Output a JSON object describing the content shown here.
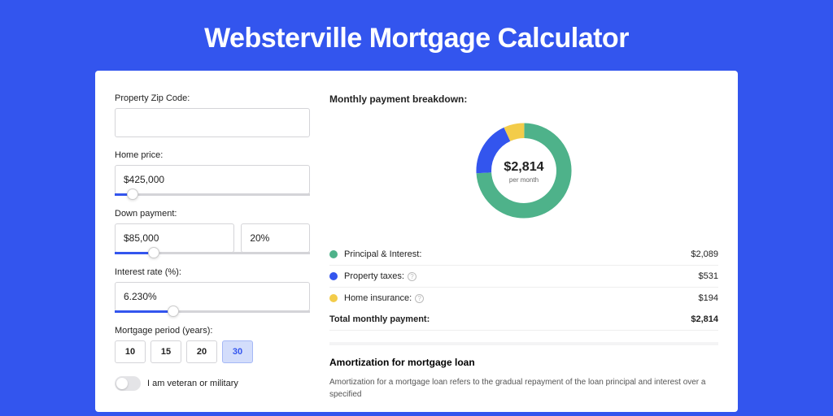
{
  "title": "Websterville Mortgage Calculator",
  "colors": {
    "principal": "#4eb28a",
    "taxes": "#3355ee",
    "insurance": "#f3cc4a"
  },
  "form": {
    "zip": {
      "label": "Property Zip Code:",
      "value": ""
    },
    "price": {
      "label": "Home price:",
      "value": "$425,000",
      "slider_pct": 9
    },
    "down": {
      "label": "Down payment:",
      "amount": "$85,000",
      "pct": "20%",
      "slider_pct": 20
    },
    "rate": {
      "label": "Interest rate (%):",
      "value": "6.230%",
      "slider_pct": 30
    },
    "period": {
      "label": "Mortgage period (years):",
      "options": [
        "10",
        "15",
        "20",
        "30"
      ],
      "selected": "30"
    },
    "veteran": {
      "label": "I am veteran or military",
      "on": false
    }
  },
  "breakdown": {
    "title": "Monthly payment breakdown:",
    "center_value": "$2,814",
    "center_sub": "per month",
    "items": [
      {
        "key": "principal",
        "label": "Principal & Interest:",
        "value": "$2,089",
        "info": false,
        "pct": 74
      },
      {
        "key": "taxes",
        "label": "Property taxes:",
        "value": "$531",
        "info": true,
        "pct": 19
      },
      {
        "key": "insurance",
        "label": "Home insurance:",
        "value": "$194",
        "info": true,
        "pct": 7
      }
    ],
    "total_label": "Total monthly payment:",
    "total_value": "$2,814"
  },
  "amort": {
    "title": "Amortization for mortgage loan",
    "text": "Amortization for a mortgage loan refers to the gradual repayment of the loan principal and interest over a specified"
  },
  "chart_data": {
    "type": "pie",
    "title": "Monthly payment breakdown",
    "series": [
      {
        "name": "Principal & Interest",
        "value": 2089
      },
      {
        "name": "Property taxes",
        "value": 531
      },
      {
        "name": "Home insurance",
        "value": 194
      }
    ],
    "total": 2814,
    "unit": "USD per month"
  }
}
